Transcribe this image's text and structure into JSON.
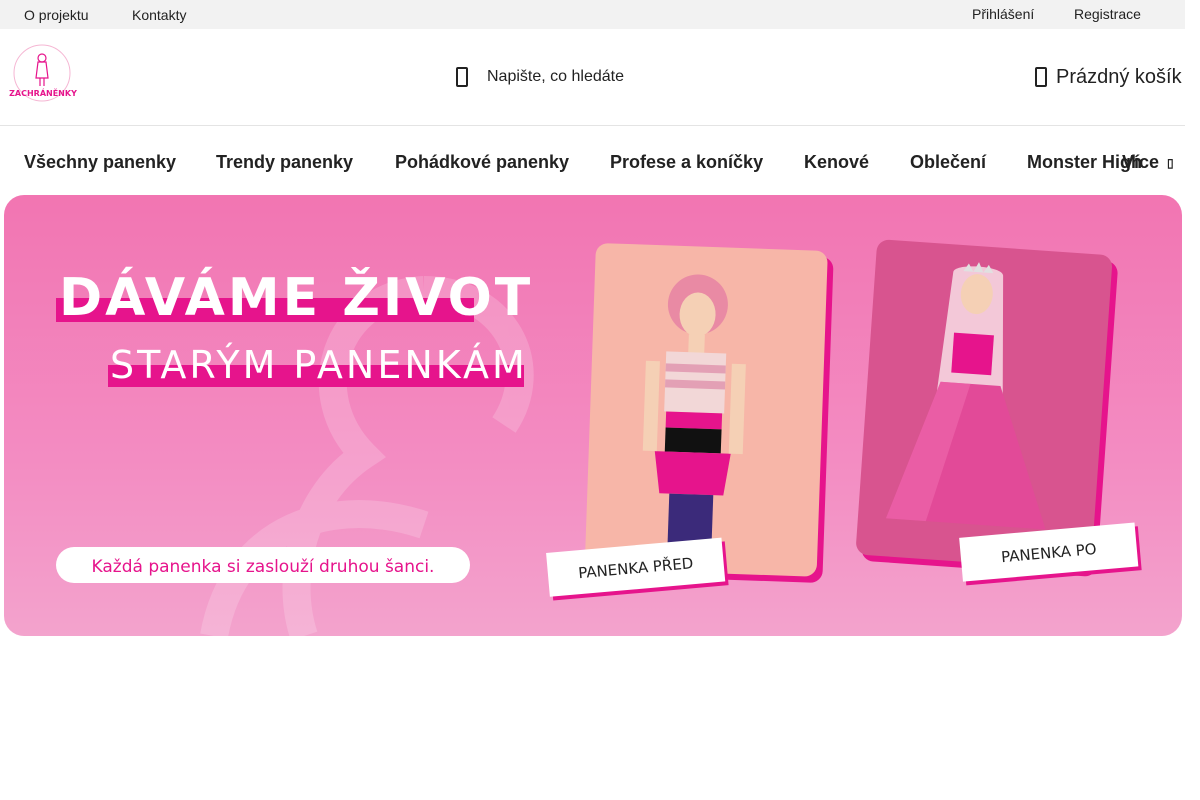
{
  "topbar": {
    "left_links": [
      "O projektu",
      "Kontakty"
    ],
    "right_links": [
      "Přihlášení",
      "Registrace"
    ]
  },
  "header": {
    "logo_text": "ZACHRÁNĚNKY",
    "search": {
      "placeholder": "Napište, co hledáte",
      "icon": "search-icon"
    },
    "cart": {
      "label": "Prázdný košík",
      "icon": "cart-icon"
    }
  },
  "nav": {
    "items": [
      "Všechny panenky",
      "Trendy panenky",
      "Pohádkové panenky",
      "Profese a koníčky",
      "Kenové",
      "Oblečení",
      "Monster High"
    ],
    "more_label": "Více"
  },
  "banner": {
    "headline_1": "DÁVÁME ŽIVOT",
    "headline_2": "STARÝM PANENKÁM",
    "tagline": "Každá panenka si zaslouží druhou šanci.",
    "before_label": "PANENKA PŘED",
    "after_label": "PANENKA PO"
  },
  "colors": {
    "accent_pink": "#e6148c",
    "banner_bg": "#f275b2",
    "topbar_bg": "#f2f2f2"
  }
}
